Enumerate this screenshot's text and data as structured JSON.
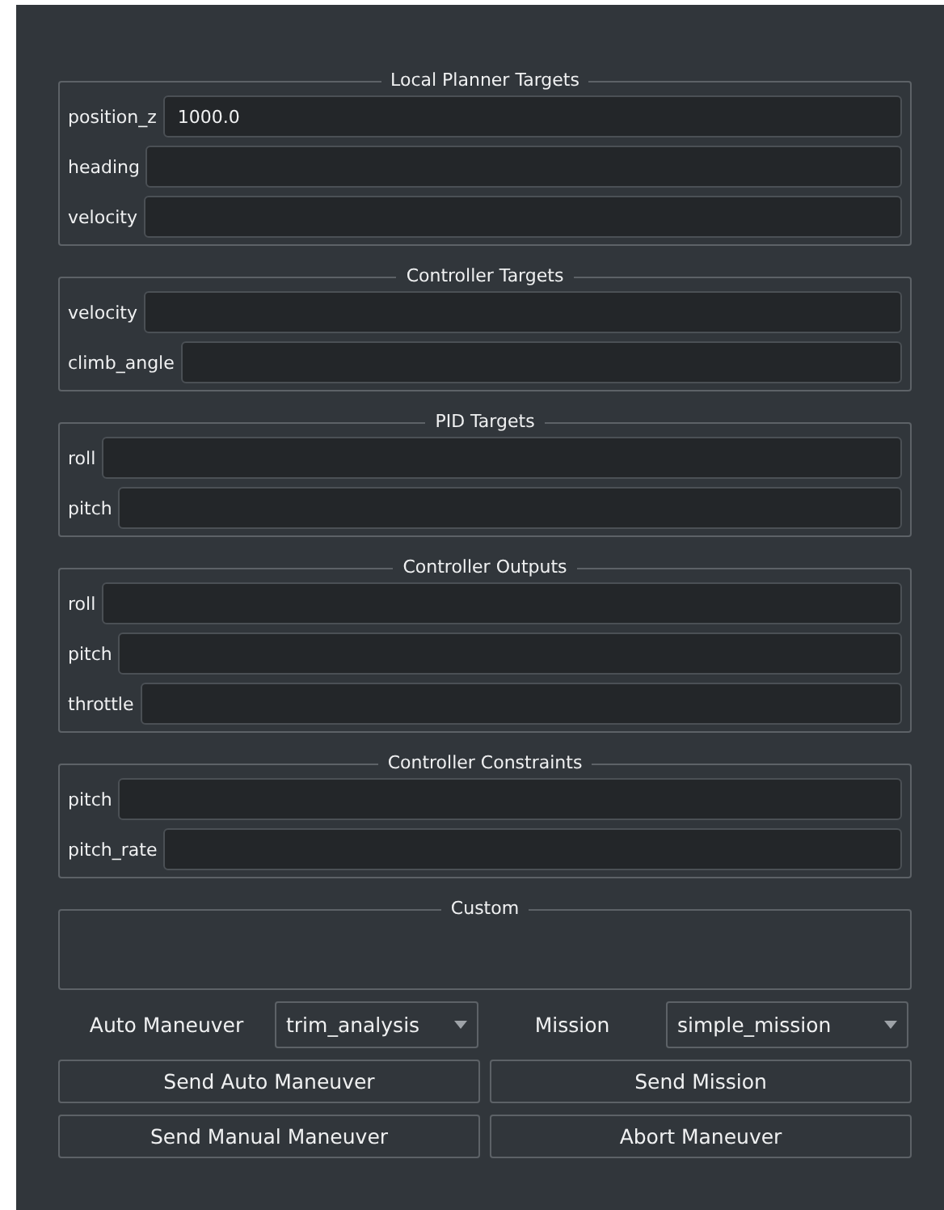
{
  "groups": [
    {
      "title": "Local Planner Targets",
      "fields": [
        {
          "label": "position_z",
          "value": "1000.0"
        },
        {
          "label": "heading"
        },
        {
          "label": "velocity"
        }
      ]
    },
    {
      "title": "Controller Targets",
      "fields": [
        {
          "label": "velocity"
        },
        {
          "label": "climb_angle"
        }
      ]
    },
    {
      "title": "PID Targets",
      "fields": [
        {
          "label": "roll"
        },
        {
          "label": "pitch"
        }
      ]
    },
    {
      "title": "Controller Outputs",
      "fields": [
        {
          "label": "roll"
        },
        {
          "label": "pitch"
        },
        {
          "label": "throttle"
        }
      ]
    },
    {
      "title": "Controller Constraints",
      "fields": [
        {
          "label": "pitch"
        },
        {
          "label": "pitch_rate"
        }
      ]
    },
    {
      "title": "Custom"
    }
  ],
  "selectors": [
    {
      "label": "Auto Maneuver",
      "value": "trim_analysis"
    },
    {
      "label": "Mission",
      "value": "simple_mission"
    }
  ],
  "buttons": [
    [
      "Send Auto Maneuver",
      "Send Mission"
    ],
    [
      "Send Manual Maneuver",
      "Abort Maneuver"
    ]
  ]
}
